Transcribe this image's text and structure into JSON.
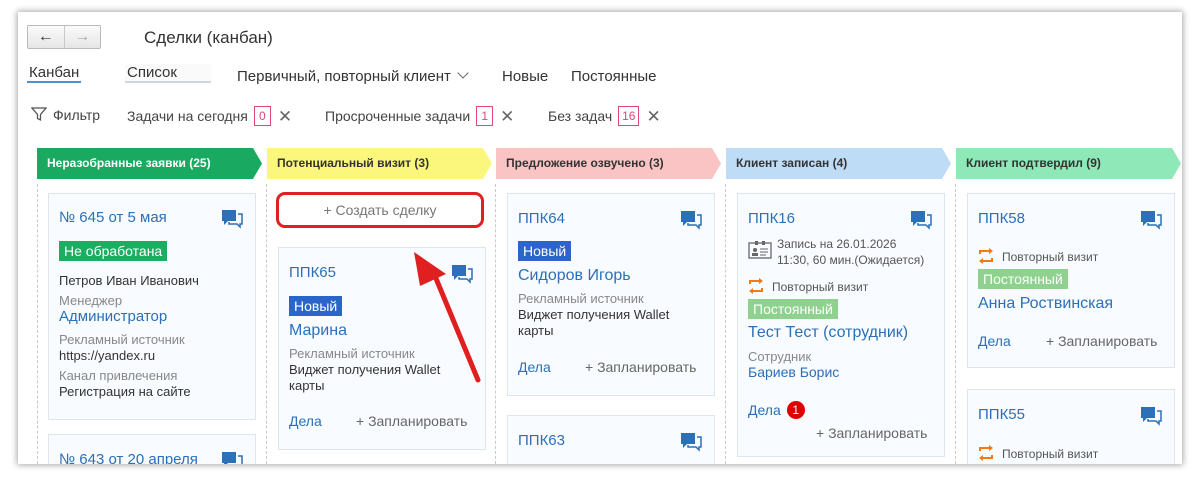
{
  "header": {
    "back_icon": "←",
    "forward_icon": "→",
    "title": "Сделки (канбан)"
  },
  "view_tabs": [
    "Канбан",
    "Список"
  ],
  "filters": {
    "client_type": "Первичный, повторный клиент",
    "new": "Новые",
    "permanent": "Постоянные"
  },
  "quick_filters": {
    "filter_label": "Фильтр",
    "items": [
      {
        "label": "Задачи на сегодня",
        "count": "0"
      },
      {
        "label": "Просроченные задачи",
        "count": "1"
      },
      {
        "label": "Без задач",
        "count": "16"
      }
    ]
  },
  "columns": [
    {
      "title": "Неразобранные заявки (25)",
      "color": "#1aa960",
      "text_color": "#ffffff"
    },
    {
      "title": "Потенциальный визит (3)",
      "color": "#fbf77c",
      "text_color": "#333333"
    },
    {
      "title": "Предложение озвучено (3)",
      "color": "#fbc4c4",
      "text_color": "#333333"
    },
    {
      "title": "Клиент записан (4)",
      "color": "#bfdcf7",
      "text_color": "#333333"
    },
    {
      "title": "Клиент подтвердил (9)",
      "color": "#8ee8b8",
      "text_color": "#333333"
    }
  ],
  "create_deal": "+ Создать сделку",
  "card_actions": {
    "tasks": "Дела",
    "plan": "+ Запланировать"
  },
  "cards": {
    "c645": {
      "title": "№ 645 от 5 мая",
      "status": "Не обработана",
      "name": "Петров Иван Иванович",
      "manager_label": "Менеджер",
      "manager": "Администратор",
      "source_label": "Рекламный источник",
      "source": "https://yandex.ru",
      "channel_label": "Канал привлечения",
      "channel": "Регистрация на сайте"
    },
    "c643": {
      "title": "№ 643 от 20 апреля"
    },
    "ppk65": {
      "title": "ППК65",
      "status": "Новый",
      "name": "Марина",
      "source_label": "Рекламный источник",
      "source_line1": "Виджет получения Wallet",
      "source_line2": "карты"
    },
    "ppk64": {
      "title": "ППК64",
      "status": "Новый",
      "name": "Сидоров Игорь",
      "source_label": "Рекламный источник",
      "source_line1": "Виджет получения Wallet",
      "source_line2": "карты"
    },
    "ppk63": {
      "title": "ППК63"
    },
    "ppk16": {
      "title": "ППК16",
      "appointment_line1": "Запись на 26.01.2026",
      "appointment_line2": "11:30, 60 мин.(Ожидается)",
      "visit": "Повторный визит",
      "status": "Постоянный",
      "name": "Тест Тест (сотрудник)",
      "employee_label": "Сотрудник",
      "employee": "Бариев Борис",
      "tasks_count": "1"
    },
    "ppk58": {
      "title": "ППК58",
      "visit": "Повторный визит",
      "status": "Постоянный",
      "name": "Анна Роствинская"
    },
    "ppk55": {
      "title": "ППК55",
      "visit": "Повторный визит"
    }
  },
  "colors": {
    "accent_link": "#2b70b8",
    "annotation_red": "#e02020",
    "count_pink": "#e0457b"
  }
}
